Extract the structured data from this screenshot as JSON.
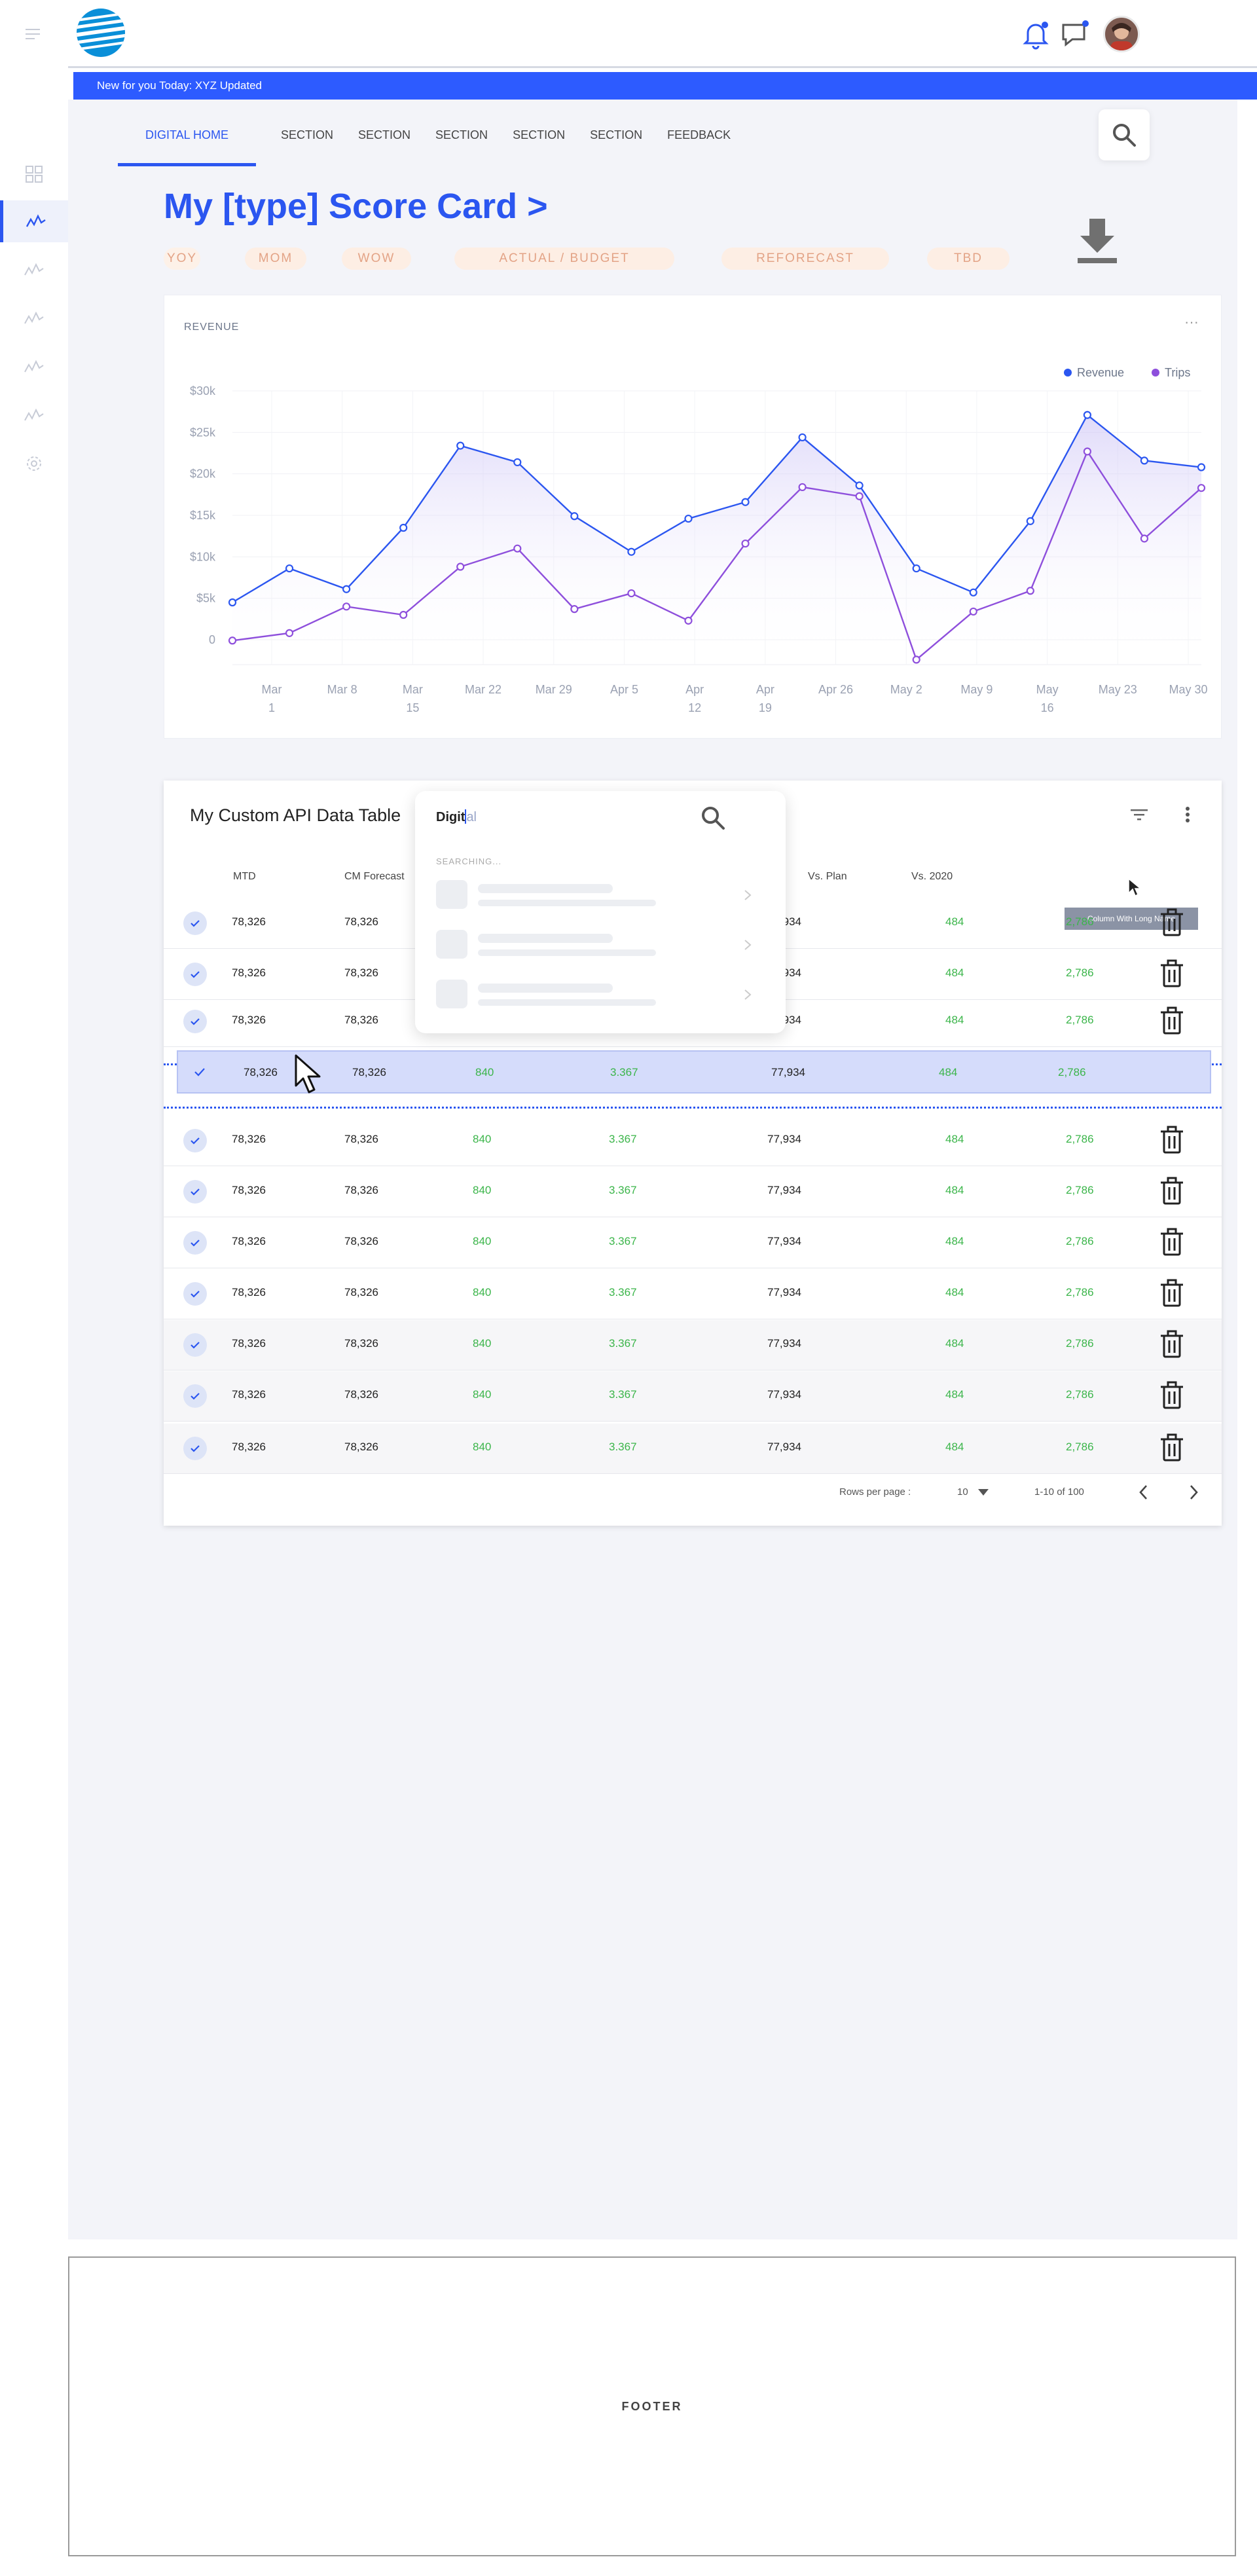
{
  "banner": {
    "text": "New for you Today:  XYZ Updated"
  },
  "nav": {
    "tabs": [
      "DIGITAL HOME",
      "SECTION",
      "SECTION",
      "SECTION",
      "SECTION",
      "SECTION",
      "FEEDBACK"
    ]
  },
  "page": {
    "title": "My [type] Score Card >",
    "chips": [
      "YOY",
      "MOM",
      "WOW",
      "ACTUAL / BUDGET",
      "REFORECAST",
      "TBD"
    ]
  },
  "revenue_card": {
    "label": "REVENUE",
    "menu": "···"
  },
  "chart_data": {
    "type": "area",
    "title": "REVENUE",
    "x": [
      "Mar 1",
      "Mar 8",
      "Mar 15",
      "Mar 22",
      "Mar 29",
      "Apr 5",
      "Apr 12",
      "Apr 19",
      "Apr 26",
      "May 2",
      "May 9",
      "May 16",
      "May 23",
      "May 30"
    ],
    "x_tick_lines": [
      [
        "Mar",
        "1"
      ],
      [
        "Mar 8"
      ],
      [
        "Mar",
        "15"
      ],
      [
        "Mar 22"
      ],
      [
        "Mar 29"
      ],
      [
        "Apr 5"
      ],
      [
        "Apr",
        "12"
      ],
      [
        "Apr",
        "19"
      ],
      [
        "Apr 26"
      ],
      [
        "May 2"
      ],
      [
        "May 9"
      ],
      [
        "May",
        "16"
      ],
      [
        "May 23"
      ],
      [
        "May 30"
      ]
    ],
    "y_ticks": [
      "$30k",
      "$25k",
      "$20k",
      "$15k",
      "$10k",
      "$5k",
      "0"
    ],
    "ylim": [
      -3000,
      30000
    ],
    "series": [
      {
        "name": "Revenue",
        "color": "#2b56f0",
        "values": [
          4500,
          8600,
          6100,
          13500,
          23400,
          21400,
          14900,
          10600,
          14600,
          16600,
          24400,
          18600,
          8600,
          5700,
          14300,
          27100,
          21600,
          20800
        ]
      },
      {
        "name": "Trips",
        "color": "#8e4fdc",
        "values": [
          -100,
          800,
          4000,
          3000,
          8800,
          11000,
          3700,
          5600,
          2300,
          11600,
          18400,
          17300,
          -2400,
          3400,
          5900,
          22700,
          12200,
          18300
        ]
      }
    ],
    "legend_position": "top-right",
    "grid": true
  },
  "table": {
    "title": "My Custom API Data Table",
    "columns": [
      "MTD",
      "CM Forecast",
      "Vs. Plan",
      "Vs. 2020"
    ],
    "rows": [
      [
        "78,326",
        "78,326",
        "840",
        "3.367",
        "77,934",
        "484",
        "2,786"
      ],
      [
        "78,326",
        "78,326",
        "840",
        "3.367",
        "77,934",
        "484",
        "2,786"
      ],
      [
        "78,326",
        "78,326",
        "840",
        "3.367",
        "77,934",
        "484",
        "2,786"
      ],
      [
        "78,326",
        "78,326",
        "840",
        "3.367",
        "77,934",
        "484",
        "2,786"
      ],
      [
        "78,326",
        "78,326",
        "840",
        "3.367",
        "77,934",
        "484",
        "2,786"
      ],
      [
        "78,326",
        "78,326",
        "840",
        "3.367",
        "77,934",
        "484",
        "2,786"
      ],
      [
        "78,326",
        "78,326",
        "840",
        "3.367",
        "77,934",
        "484",
        "2,786"
      ],
      [
        "78,326",
        "78,326",
        "840",
        "3.367",
        "77,934",
        "484",
        "2,786"
      ],
      [
        "78,326",
        "78,326",
        "840",
        "3.367",
        "77,934",
        "484",
        "2,786"
      ],
      [
        "78,326",
        "78,326",
        "840",
        "3.367",
        "77,934",
        "484",
        "2,786"
      ],
      [
        "78,326",
        "78,326",
        "840",
        "3.367",
        "77,934",
        "484",
        "2,786"
      ]
    ],
    "dragged_row": [
      "78,326",
      "78,326",
      "840",
      "3.367",
      "77,934",
      "484",
      "2,786"
    ],
    "tooltip": "Column With Long Name",
    "search": {
      "typed": "Digit",
      "placeholder_rest": "al",
      "status": "SEARCHING..."
    },
    "pager": {
      "rows_label": "Rows per page :",
      "rows_value": "10",
      "range": "1-10 of 100"
    }
  },
  "footer": {
    "label": "FOOTER"
  }
}
